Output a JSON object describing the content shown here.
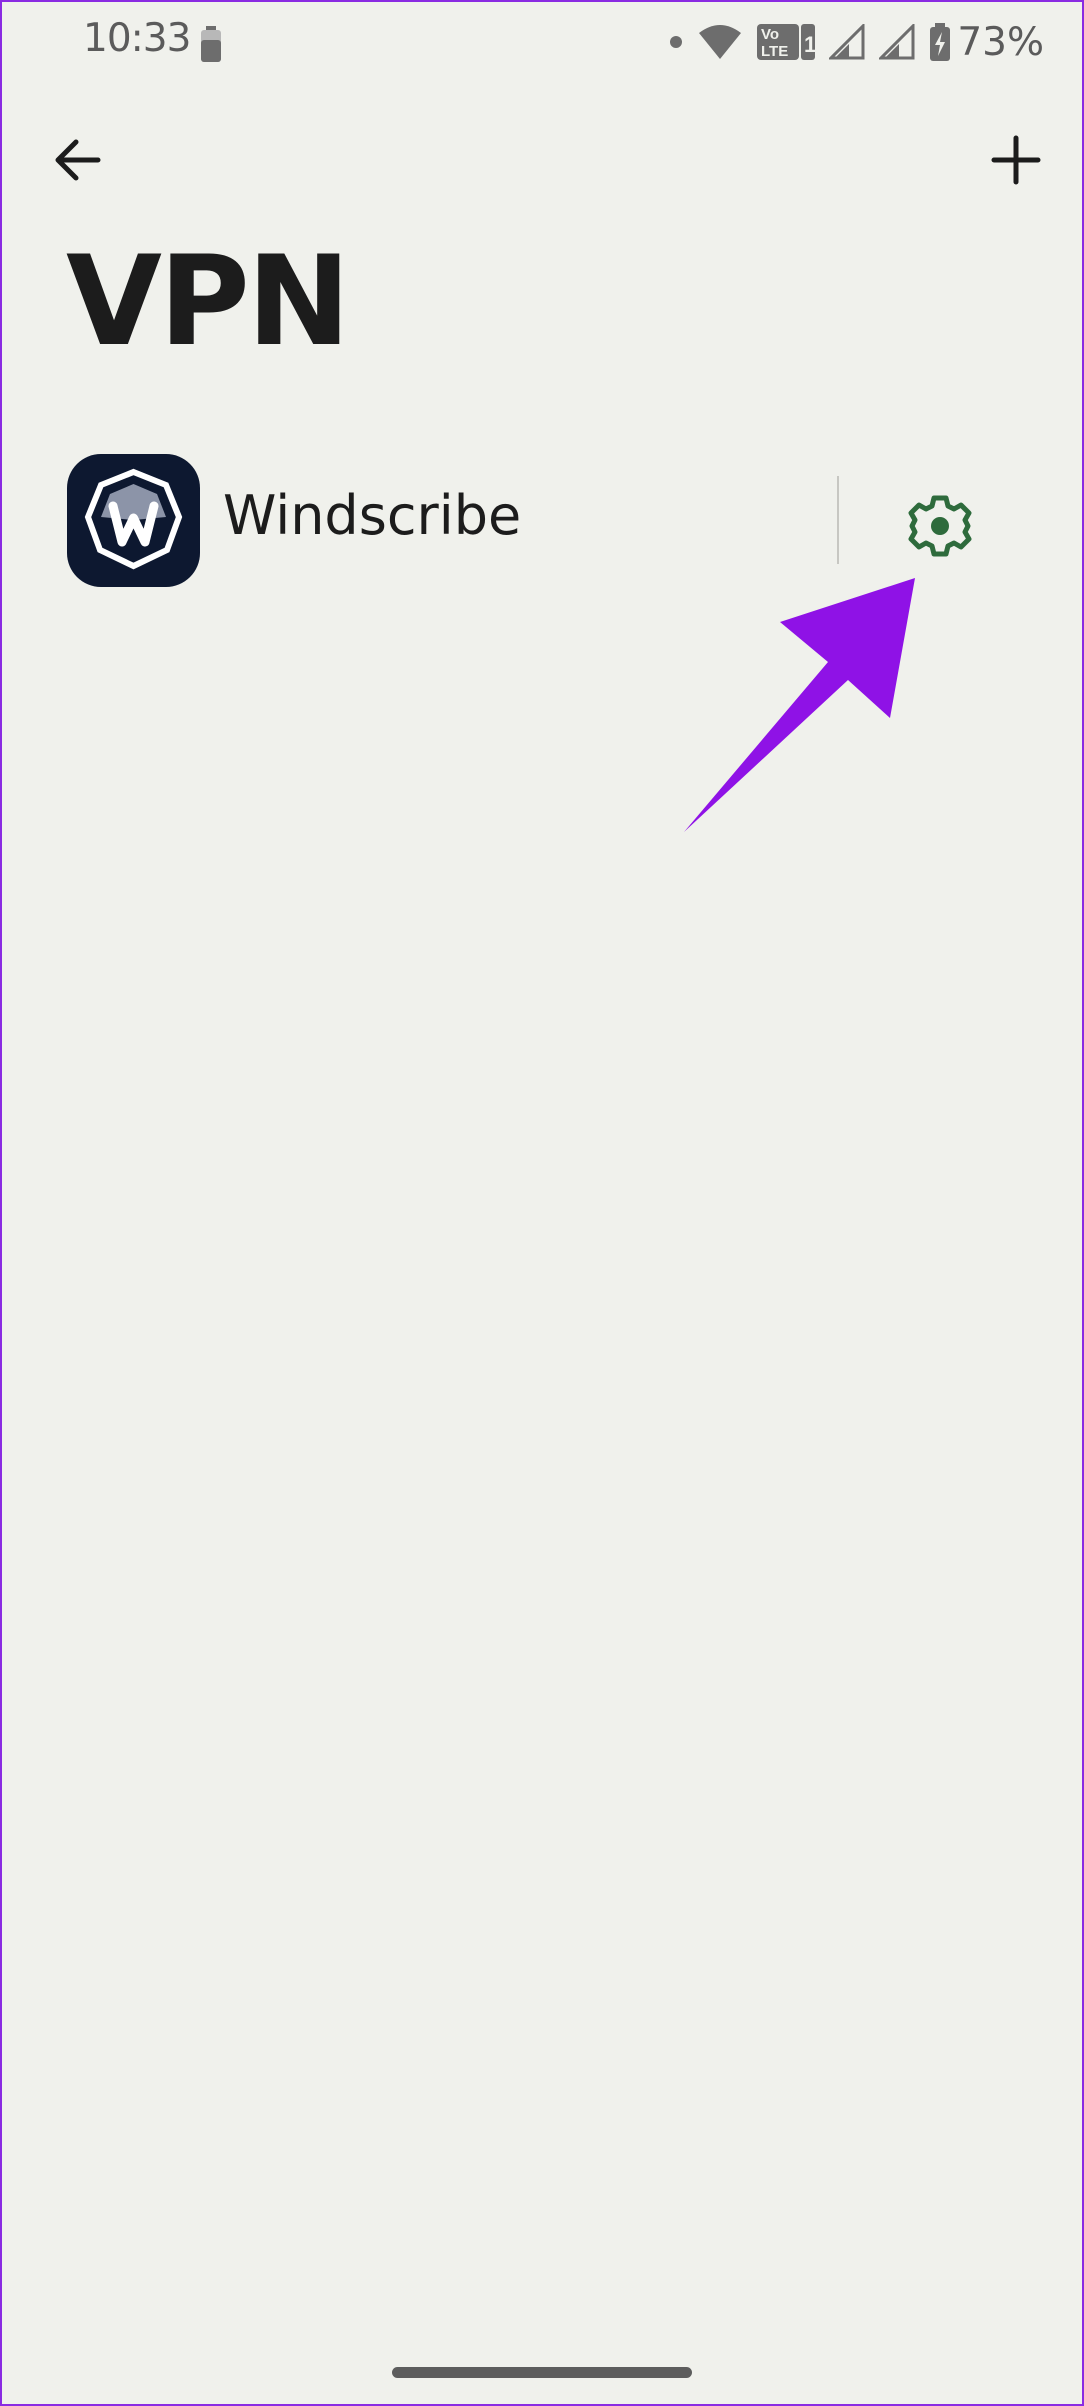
{
  "status": {
    "time": "10:33",
    "battery_pct": "73%",
    "volte_line1": "Vo",
    "volte_line2": "LTE",
    "sim_slot": "1"
  },
  "appbar": {
    "back_icon": "arrow-left-icon",
    "add_icon": "plus-icon"
  },
  "page": {
    "title": "VPN"
  },
  "vpn_list": [
    {
      "name": "Windscribe",
      "icon": "windscribe-logo",
      "settings_icon": "gear-icon",
      "settings_color": "#2e6b3c"
    }
  ],
  "colors": {
    "background": "#f0f1ec",
    "annotation_arrow": "#8f12e6",
    "text": "#1c1c1c"
  }
}
